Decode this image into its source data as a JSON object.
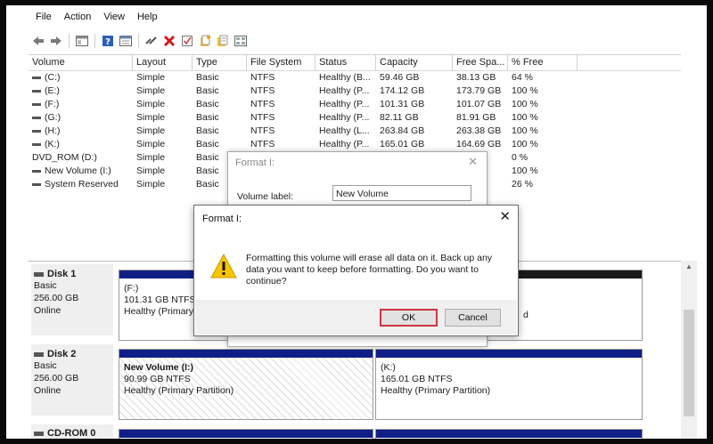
{
  "menu": [
    "File",
    "Action",
    "View",
    "Help"
  ],
  "toolbar_icons": [
    "back-arrow-icon",
    "forward-arrow-icon",
    "console-icon",
    "help-icon",
    "properties-icon",
    "connect-icon",
    "delete-icon",
    "check-icon",
    "new-volume-icon",
    "format-icon",
    "view-icon"
  ],
  "columns": [
    "Volume",
    "Layout",
    "Type",
    "File System",
    "Status",
    "Capacity",
    "Free Spa...",
    "% Free"
  ],
  "volumes": [
    {
      "icon": "bar",
      "name": "(C:)",
      "layout": "Simple",
      "type": "Basic",
      "fs": "NTFS",
      "status": "Healthy (B...",
      "capacity": "59.46 GB",
      "free": "38.13 GB",
      "pct": "64 %"
    },
    {
      "icon": "bar",
      "name": "(E:)",
      "layout": "Simple",
      "type": "Basic",
      "fs": "NTFS",
      "status": "Healthy (P...",
      "capacity": "174.12 GB",
      "free": "173.79 GB",
      "pct": "100 %"
    },
    {
      "icon": "bar",
      "name": "(F:)",
      "layout": "Simple",
      "type": "Basic",
      "fs": "NTFS",
      "status": "Healthy (P...",
      "capacity": "101.31 GB",
      "free": "101.07 GB",
      "pct": "100 %"
    },
    {
      "icon": "bar",
      "name": "(G:)",
      "layout": "Simple",
      "type": "Basic",
      "fs": "NTFS",
      "status": "Healthy (P...",
      "capacity": "82.11 GB",
      "free": "81.91 GB",
      "pct": "100 %"
    },
    {
      "icon": "bar",
      "name": "(H:)",
      "layout": "Simple",
      "type": "Basic",
      "fs": "NTFS",
      "status": "Healthy (L...",
      "capacity": "263.84 GB",
      "free": "263.38 GB",
      "pct": "100 %"
    },
    {
      "icon": "bar",
      "name": "(K:)",
      "layout": "Simple",
      "type": "Basic",
      "fs": "NTFS",
      "status": "Healthy (P...",
      "capacity": "165.01 GB",
      "free": "164.69 GB",
      "pct": "100 %"
    },
    {
      "icon": "none",
      "name": "DVD_ROM (D:)",
      "layout": "Simple",
      "type": "Basic",
      "fs": "",
      "status": "",
      "capacity": "",
      "free": "",
      "pct": "0 %"
    },
    {
      "icon": "bar",
      "name": "New Volume (I:)",
      "layout": "Simple",
      "type": "Basic",
      "fs": "",
      "status": "",
      "capacity": "",
      "free": "GB",
      "pct": "100 %"
    },
    {
      "icon": "bar",
      "name": "System Reserved",
      "layout": "Simple",
      "type": "Basic",
      "fs": "",
      "status": "",
      "capacity": "",
      "free": "MB",
      "pct": "26 %"
    }
  ],
  "disks": [
    {
      "name": "Disk 1",
      "kind": "Basic",
      "size": "256.00 GB",
      "state": "Online",
      "partitions": [
        {
          "name": "(F:)",
          "size": "101.31 GB NTFS",
          "status": "Healthy (Primary Partition)"
        },
        {
          "name": "",
          "size": "",
          "status": "d"
        }
      ]
    },
    {
      "name": "Disk 2",
      "kind": "Basic",
      "size": "256.00 GB",
      "state": "Online",
      "partitions": [
        {
          "name": "New Volume  (I:)",
          "size": "90.99 GB NTFS",
          "status": "Healthy (Primary Partition)"
        },
        {
          "name": "(K:)",
          "size": "165.01 GB NTFS",
          "status": "Healthy (Primary Partition)"
        }
      ]
    },
    {
      "name": "CD-ROM 0"
    }
  ],
  "format_dialog": {
    "title": "Format I:",
    "label": "Volume label:",
    "value": "New Volume"
  },
  "alert": {
    "title": "Format I:",
    "message": "Formatting this volume will erase all data on it. Back up any data you want to keep before formatting. Do you want to continue?",
    "ok": "OK",
    "cancel": "Cancel",
    "warning_color": "#f7c600",
    "focus_color": "#d0343d"
  },
  "colors": {
    "partition_bar": "#101f86",
    "frame": "#0a0a0a"
  }
}
